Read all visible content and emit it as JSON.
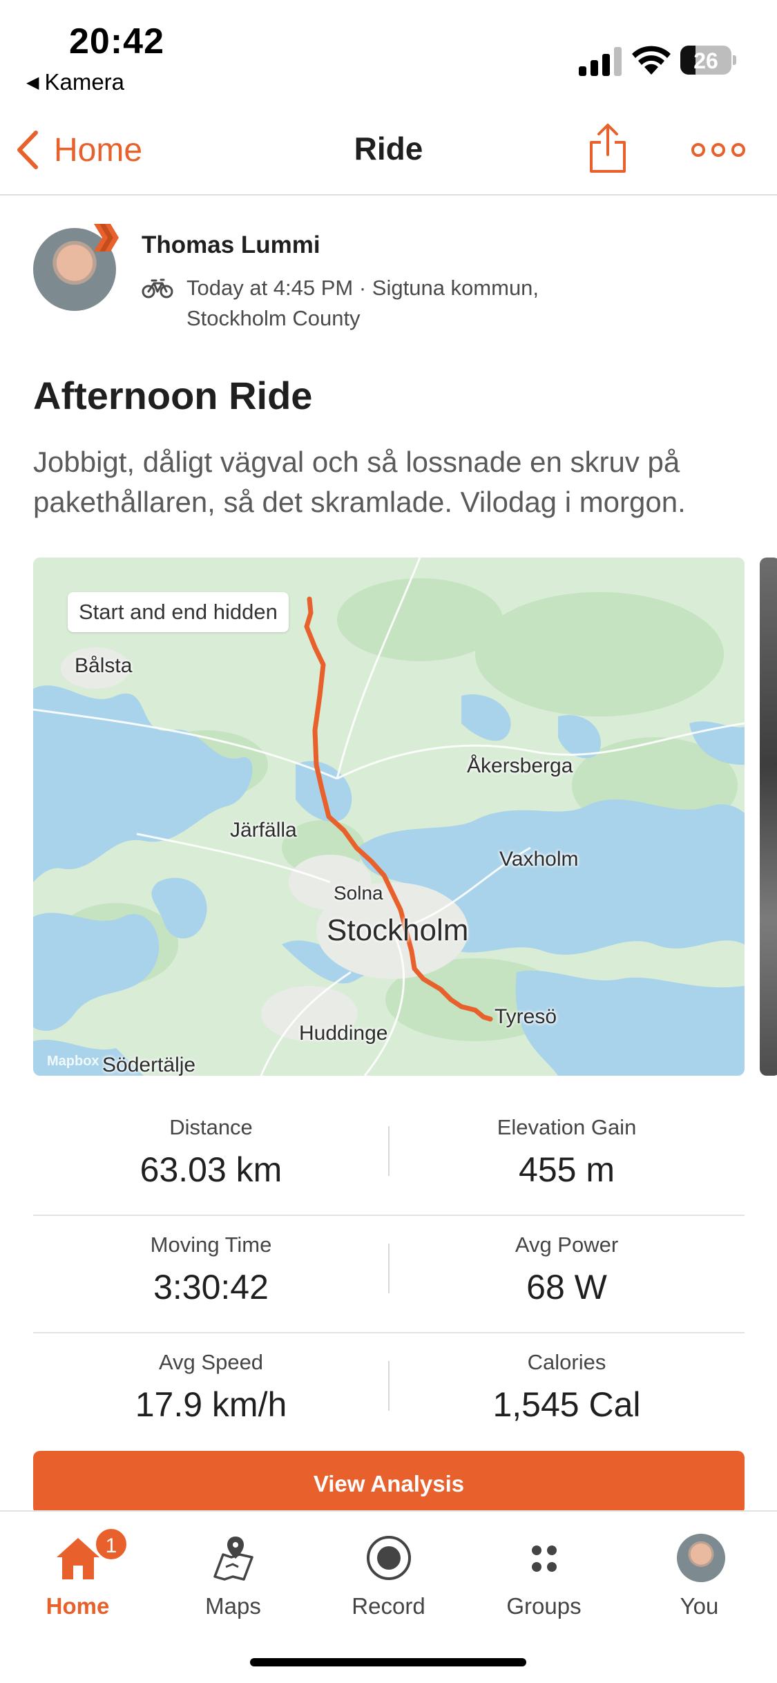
{
  "status_bar": {
    "time": "20:42",
    "back_app": "Kamera",
    "battery": "26"
  },
  "nav": {
    "back_label": "Home",
    "title": "Ride"
  },
  "activity": {
    "athlete_name": "Thomas Lummi",
    "meta": "Today at 4:45 PM · Sigtuna kommun, Stockholm County",
    "title": "Afternoon Ride",
    "description": "Jobbigt, dåligt vägval och så lossnade en skruv på pakethållaren, så det skramlade. Vilodag i morgon."
  },
  "map": {
    "privacy_chip": "Start and end hidden",
    "labels": {
      "balsta": "Bålsta",
      "akersberga": "Åkersberga",
      "jarfalla": "Järfälla",
      "vaxholm": "Vaxholm",
      "solna": "Solna",
      "stockholm": "Stockholm",
      "tyreso": "Tyresö",
      "huddinge": "Huddinge",
      "sodertalje": "Södertälje",
      "mapbox": "Mapbox"
    },
    "route_color": "#e8612c"
  },
  "stats": [
    {
      "label": "Distance",
      "value": "63.03 km"
    },
    {
      "label": "Elevation Gain",
      "value": "455 m"
    },
    {
      "label": "Moving Time",
      "value": "3:30:42"
    },
    {
      "label": "Avg Power",
      "value": "68 W"
    },
    {
      "label": "Avg Speed",
      "value": "17.9 km/h"
    },
    {
      "label": "Calories",
      "value": "1,545 Cal"
    }
  ],
  "analysis_button": "View Analysis",
  "tabs": {
    "home": {
      "label": "Home",
      "badge": "1",
      "icon": "home-icon"
    },
    "maps": {
      "label": "Maps",
      "icon": "maps-icon"
    },
    "record": {
      "label": "Record",
      "icon": "record-icon"
    },
    "groups": {
      "label": "Groups",
      "icon": "groups-icon"
    },
    "you": {
      "label": "You",
      "icon": "avatar"
    }
  },
  "colors": {
    "accent": "#e8612c",
    "map_land": "#d8ecd6",
    "map_water": "#a9d3ea"
  }
}
